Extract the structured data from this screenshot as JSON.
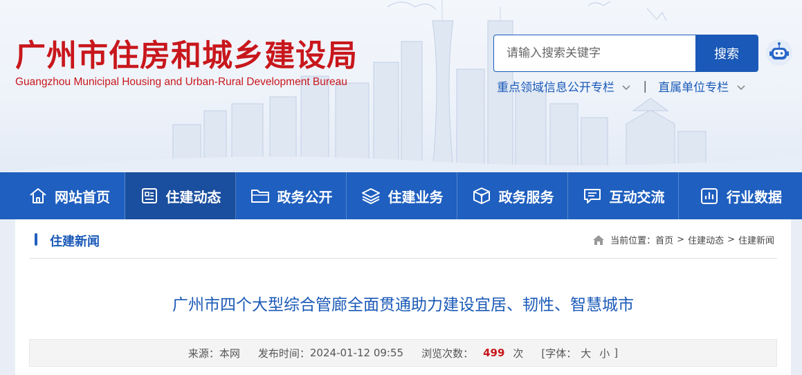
{
  "site": {
    "title_cn": "广州市住房和城乡建设局",
    "title_en": "Guangzhou Municipal Housing and Urban-Rural Development Bureau",
    "brand_color": "#c8171c",
    "accent_color": "#1a59b7"
  },
  "search": {
    "placeholder": "请输入搜索关键字",
    "button_label": "搜索"
  },
  "header_links": [
    {
      "label": "重点领域信息公开专栏"
    },
    {
      "label": "直属单位专栏"
    }
  ],
  "header_link_separator": "|",
  "nav": [
    {
      "label": "网站首页",
      "icon": "home-icon"
    },
    {
      "label": "住建动态",
      "icon": "news-icon"
    },
    {
      "label": "政务公开",
      "icon": "folder-icon"
    },
    {
      "label": "住建业务",
      "icon": "layers-icon"
    },
    {
      "label": "政务服务",
      "icon": "box-icon"
    },
    {
      "label": "互动交流",
      "icon": "chat-icon"
    },
    {
      "label": "行业数据",
      "icon": "chart-icon"
    }
  ],
  "section": {
    "title": "住建新闻"
  },
  "breadcrumb": {
    "prefix": "当前位置：",
    "items": [
      "首页",
      "住建动态",
      "住建新闻"
    ],
    "separator": ">"
  },
  "article": {
    "title": "广州市四个大型综合管廊全面贯通助力建设宜居、韧性、智慧城市",
    "source_label": "来源：",
    "source_value": "本网",
    "time_label": "发布时间：",
    "time_value": "2024-01-12 09:55",
    "views_label": "浏览次数：",
    "views_value": "499",
    "views_unit": "次",
    "font_label": "[字体：",
    "font_large": "大",
    "font_small": "小",
    "font_close": "]"
  }
}
